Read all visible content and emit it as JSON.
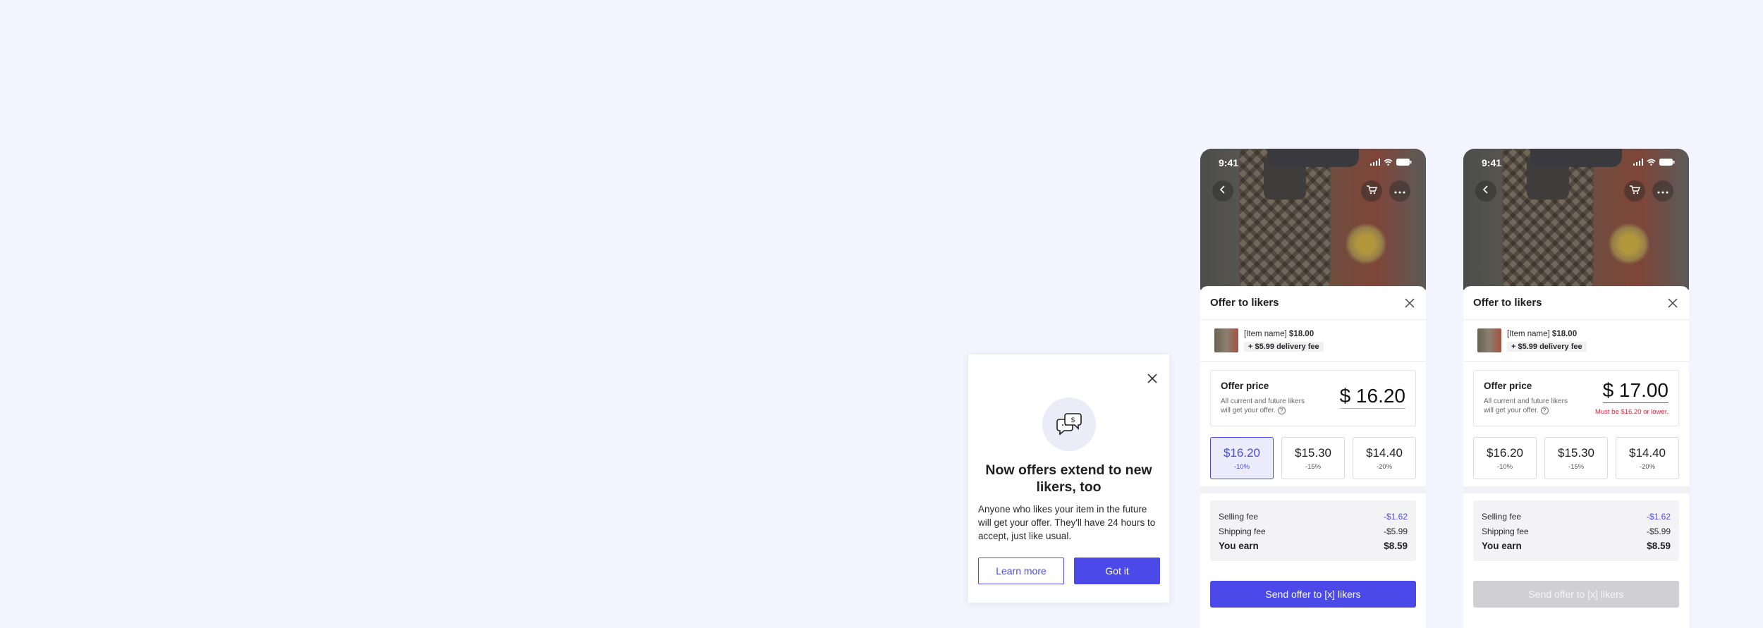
{
  "colors": {
    "accent": "#4b4ae8",
    "error": "#d6263b",
    "background": "#f4f4fe",
    "disabled": "#cfcfd4"
  },
  "popup": {
    "icon": "chat-dollar-icon",
    "title": "Now offers extend to new likers, too",
    "body": "Anyone who likes your item in the future will get your offer. They'll have 24 hours to accept, just like usual.",
    "learn_more_label": "Learn more",
    "got_it_label": "Got it"
  },
  "phones": [
    {
      "status_time": "9:41",
      "sheet_title": "Offer to likers",
      "item": {
        "name": "[Item name]",
        "price": "$18.00",
        "delivery_fee": "+ $5.99 delivery fee"
      },
      "offer": {
        "label": "Offer price",
        "help": "All current and future likers will get your offer.",
        "help_icon": "?",
        "amount": "$ 16.20",
        "error": ""
      },
      "chips": [
        {
          "amount": "$16.20",
          "pct": "-10%",
          "selected": true
        },
        {
          "amount": "$15.30",
          "pct": "-15%",
          "selected": false
        },
        {
          "amount": "$14.40",
          "pct": "-20%",
          "selected": false
        }
      ],
      "fees": [
        {
          "label": "Selling fee",
          "value": "-$1.62"
        },
        {
          "label": "Shipping fee",
          "value": "-$5.99"
        },
        {
          "label": "You earn",
          "value": "$8.59"
        }
      ],
      "send_label": "Send offer to [x] likers",
      "send_enabled": true
    },
    {
      "status_time": "9:41",
      "sheet_title": "Offer to likers",
      "item": {
        "name": "[Item name]",
        "price": "$18.00",
        "delivery_fee": "+ $5.99 delivery fee"
      },
      "offer": {
        "label": "Offer price",
        "help": "All current and future likers will get your offer.",
        "help_icon": "?",
        "amount": "$ 17.00",
        "error": "Must be $16.20 or lower."
      },
      "chips": [
        {
          "amount": "$16.20",
          "pct": "-10%",
          "selected": false
        },
        {
          "amount": "$15.30",
          "pct": "-15%",
          "selected": false
        },
        {
          "amount": "$14.40",
          "pct": "-20%",
          "selected": false
        }
      ],
      "fees": [
        {
          "label": "Selling fee",
          "value": "-$1.62"
        },
        {
          "label": "Shipping fee",
          "value": "-$5.99"
        },
        {
          "label": "You earn",
          "value": "$8.59"
        }
      ],
      "send_label": "Send offer to [x] likers",
      "send_enabled": false
    }
  ]
}
